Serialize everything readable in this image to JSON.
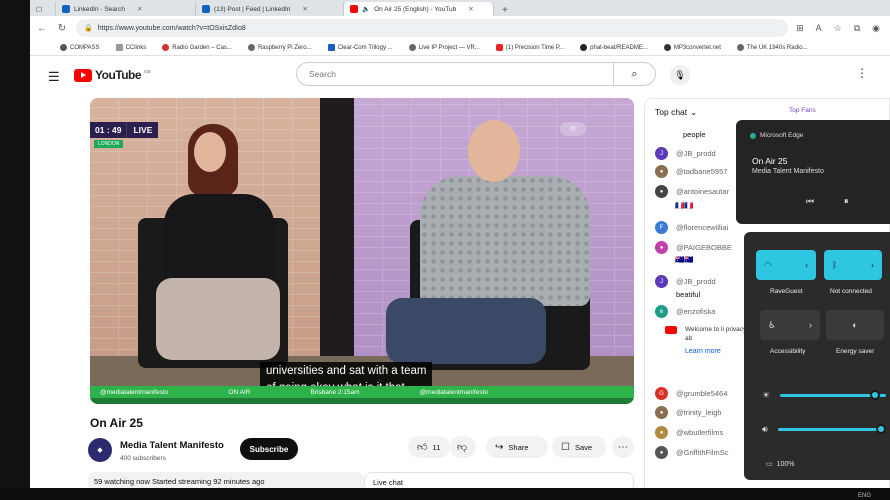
{
  "browser": {
    "tabs": [
      {
        "label": "LinkedIn - Search",
        "color": "#0a66c2"
      },
      {
        "label": "(13) Post | Feed | LinkedIn",
        "color": "#0a66c2"
      },
      {
        "label": "On Air 25 (English) - YouTub",
        "color": "#ff0000",
        "active": true
      }
    ],
    "url": "https://www.youtube.com/watch?v=tOSxisZdIo8",
    "bookmarks": [
      "COMPASS",
      "CClinks",
      "Radio Garden – Cas...",
      "Raspberry Pi Zero...",
      "Clear-Com Trilogy ...",
      "Live IP Project — VR...",
      "(1) Precision Time P...",
      "phat-beat/README...",
      "MP3converter.net",
      "The UK 1940s Radio..."
    ]
  },
  "youtube": {
    "logo_text": "YouTube",
    "logo_region": "GB",
    "search_placeholder": "Search"
  },
  "video": {
    "live_time": "01 : 49",
    "live_label": "LIVE",
    "location": "LONDON",
    "subtitle_line1": "universities and sat with a team",
    "subtitle_line2": "of going okay what is it that",
    "ticker_items": [
      "@mediatalentmanifesto",
      "ON AIR",
      "Brisbane 2:15am",
      "@mediatalentmanifesto"
    ],
    "title": "On Air 25"
  },
  "channel": {
    "name": "Media Talent Manifesto",
    "subscribers": "400 subscribers",
    "subscribe_label": "Subscribe"
  },
  "actions": {
    "likes": "11",
    "share_label": "Share",
    "save_label": "Save"
  },
  "description": {
    "text": "59 watching now  Started streaming 92 minutes ago"
  },
  "live_chat": {
    "header": "Top chat",
    "top_fans": "Top Fans",
    "collapsed_label": "Live chat",
    "messages": [
      {
        "user": "people",
        "text": "",
        "avatar_color": "#ffffff"
      },
      {
        "user": "@JB_prodd",
        "text": "",
        "avatar_color": "#5c3bb8"
      },
      {
        "user": "@tadbane5957",
        "text": "",
        "avatar_color": "#8a6e52"
      },
      {
        "user": "@antoinesautar",
        "text": "",
        "avatar_color": "#444444"
      },
      {
        "user": "",
        "text": "🇫🇷🇫🇷",
        "avatar_color": "#ffffff"
      },
      {
        "user": "@florencewilliai",
        "text": "",
        "avatar_color": "#3a7bd5"
      },
      {
        "user": "@PAIGEBOBBE",
        "text": "",
        "avatar_color": "#c03fa8"
      },
      {
        "user": "",
        "text": "🇦🇺🇦🇺",
        "avatar_color": "#ffffff"
      },
      {
        "user": "@JB_prodd",
        "text": "",
        "avatar_color": "#5c3bb8"
      },
      {
        "user": "beatiful",
        "text": "",
        "avatar_color": "#ffffff"
      },
      {
        "user": "@enzofiska",
        "text": "",
        "avatar_color": "#1e9e8a"
      }
    ],
    "notice_text": "Welcome to live chat! Remember to guard your privacy and abide by our community guidelines.",
    "notice_visible": "Welcome to li privacy and ab",
    "learn_more": "Learn more",
    "lower_messages": [
      {
        "user": "@grumble5464",
        "avatar_color": "#d93025"
      },
      {
        "user": "@trinity_leigh",
        "avatar_color": "#8a6e52"
      },
      {
        "user": "@wbutlerfilms",
        "avatar_color": "#b08a3e"
      },
      {
        "user": "@GriffithFilmSc",
        "avatar_color": "#555555"
      }
    ]
  },
  "media_flyout": {
    "app": "Microsoft Edge",
    "title": "On Air 25",
    "subtitle": "Media Talent Manifesto"
  },
  "quick_settings": {
    "wifi_label": "RaveGuest",
    "bluetooth_label": "Not connected",
    "accessibility_label": "Accessibility",
    "energy_label": "Energy saver",
    "battery": "100%",
    "brightness_level": 0.92,
    "volume_level": 0.95
  },
  "taskbar": {
    "language": "ENG"
  }
}
